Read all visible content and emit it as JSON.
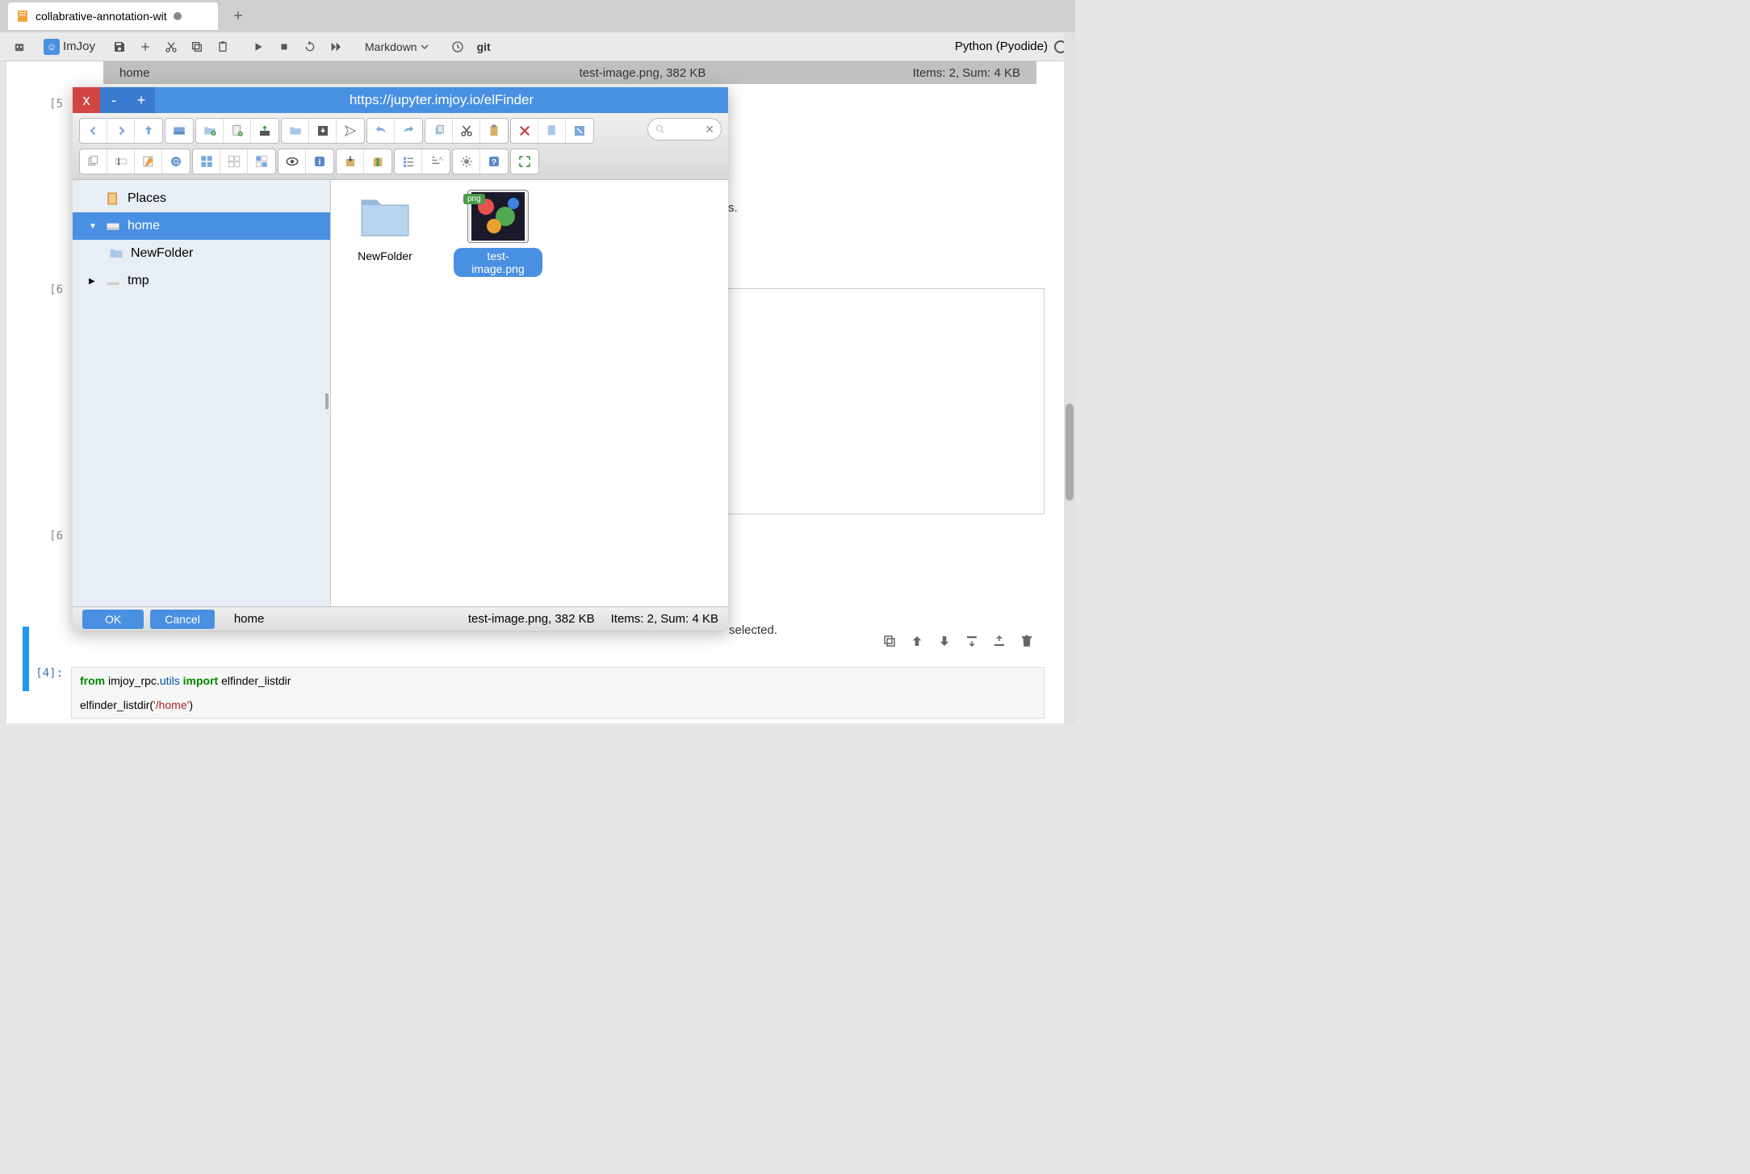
{
  "tab": {
    "title": "collabrative-annotation-wit"
  },
  "toolbar": {
    "imjoy": "ImJoy",
    "cell_type": "Markdown",
    "git": "git",
    "kernel": "Python (Pyodide)"
  },
  "notebook": {
    "strip": {
      "left": "home",
      "mid": "test-image.png, 382 KB",
      "right": "Items: 2, Sum: 4 KB"
    },
    "p5": "[5",
    "p6a": "[6",
    "p6b": "[6",
    "p4": "[4]:",
    "partial_s": "s.",
    "partial_sel": " selected.",
    "code4_l1_kw1": "from",
    "code4_l1_mod": "imjoy_rpc.",
    "code4_l1_utils": "utils",
    "code4_l1_kw2": "import",
    "code4_l1_fn": "elfinder_listdir",
    "code4_l2_fn": "elfinder_listdir",
    "code4_l2_paren1": "(",
    "code4_l2_str": "'/home'",
    "code4_l2_paren2": ")"
  },
  "modal": {
    "title": "https://jupyter.imjoy.io/elFinder",
    "close": "x",
    "minimize": "-",
    "maximize": "+",
    "search_placeholder": "",
    "sidebar": {
      "places": "Places",
      "home": "home",
      "newfolder": "NewFolder",
      "tmp": "tmp"
    },
    "items": {
      "folder": "NewFolder",
      "image": "test-image.png",
      "badge": "png"
    },
    "footer": {
      "ok": "OK",
      "cancel": "Cancel",
      "path": "home",
      "file": "test-image.png, 382 KB",
      "summary": "Items: 2, Sum: 4 KB"
    }
  }
}
